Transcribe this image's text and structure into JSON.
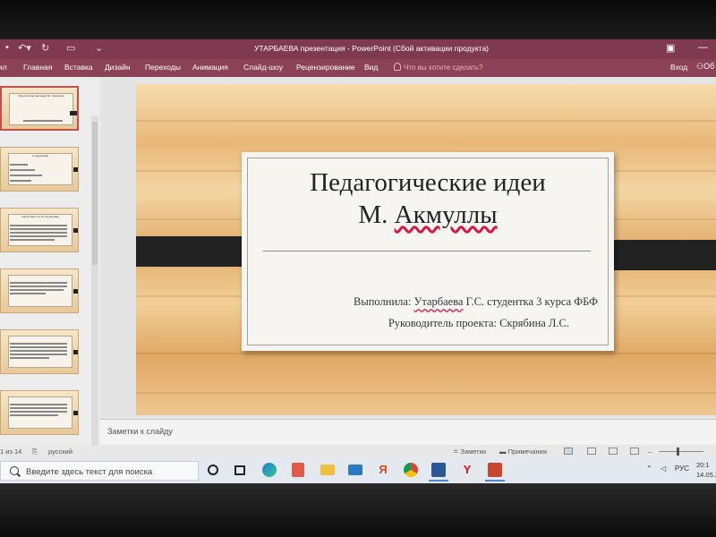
{
  "window": {
    "title": "УТАРБАЕВА презентация - PowerPoint (Сбой активации продукта)",
    "login": "Вход",
    "share_label": "Об"
  },
  "ribbon": {
    "tabs": [
      "ил",
      "Главная",
      "Вставка",
      "Дизайн",
      "Переходы",
      "Анимация",
      "Слайд-шоу",
      "Рецензирование",
      "Вид"
    ],
    "tell_me": "Что вы хотите сделать?"
  },
  "thumbnails": [
    {
      "title": "Педагогические идеи М. Акмуллы",
      "selected": true
    },
    {
      "title": "Содержание",
      "selected": false
    },
    {
      "title": "Актуальность исследования",
      "selected": false
    },
    {
      "title": "",
      "selected": false
    },
    {
      "title": "",
      "selected": false
    },
    {
      "title": "",
      "selected": false
    }
  ],
  "slide": {
    "title_line1": "Педагогические идеи",
    "title_line2_plain": "М. ",
    "title_line2_squiggly": "Акмуллы",
    "author_label": "Выполнила: ",
    "author_name": "Утарбаева",
    "author_rest": " Г.С. студентка 3 курса ФБФ",
    "lead": "Руководитель проекта: Скрябина Л.С."
  },
  "notes_placeholder": "Заметки к слайду",
  "status": {
    "slide_counter": "1 из 14",
    "language": "русский",
    "notes_btn": "Заметки",
    "comments_btn": "Примечания"
  },
  "taskbar": {
    "search_placeholder": "Введите здесь текст для поиска",
    "lang": "РУС",
    "time": "20:1",
    "date": "14.05.2"
  },
  "colors": {
    "title_bar": "#7f3a52",
    "ribbon": "#8b4258",
    "accent_selected": "#c0504d"
  }
}
